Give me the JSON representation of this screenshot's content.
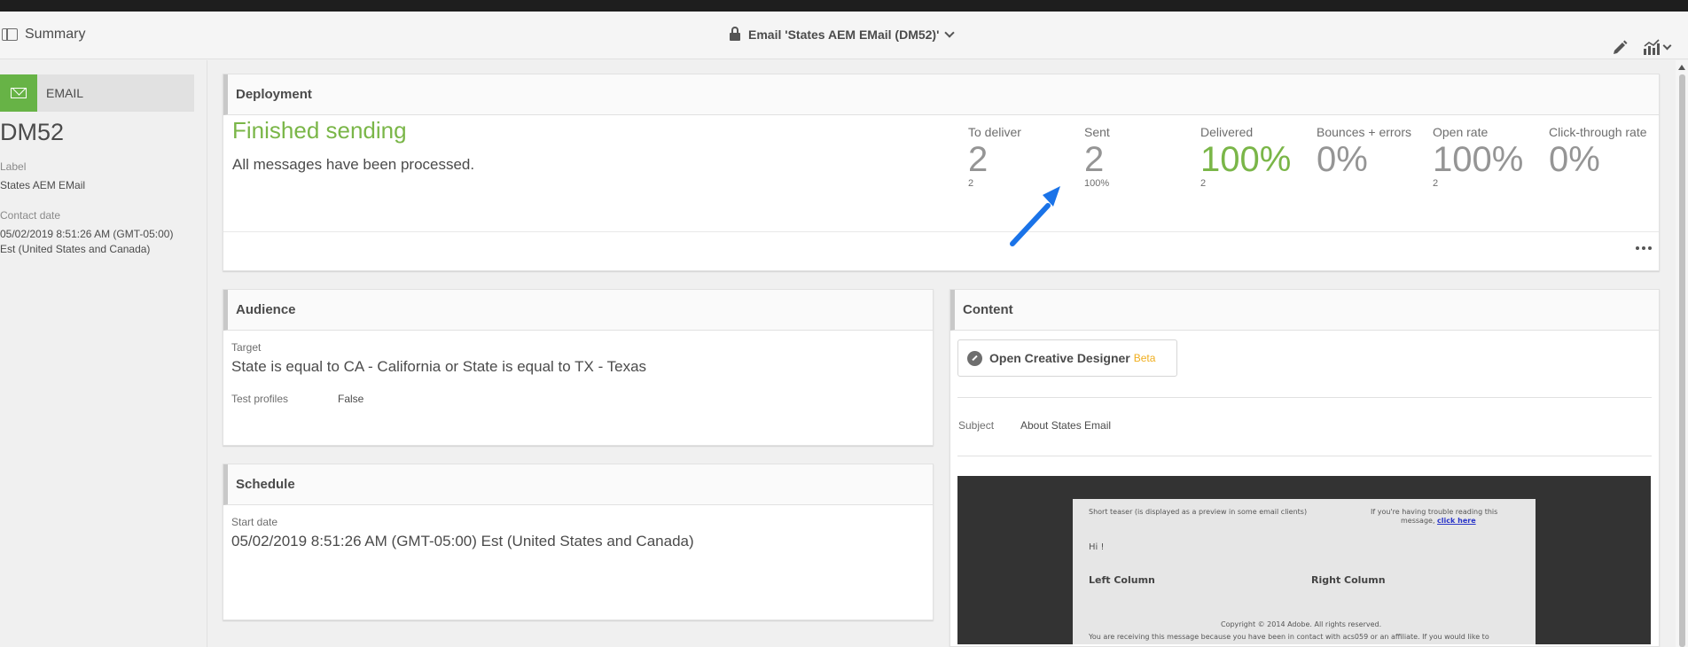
{
  "header": {
    "summary_label": "Summary",
    "title": "Email 'States AEM EMail (DM52)'"
  },
  "sidebar": {
    "channel_label": "EMAIL",
    "code": "DM52",
    "label_caption": "Label",
    "label_value": "States AEM EMail",
    "contact_caption": "Contact date",
    "contact_value": "05/02/2019 8:51:26 AM (GMT-05:00) Est (United States and Canada)"
  },
  "deployment": {
    "title": "Deployment",
    "status": "Finished sending",
    "description": "All messages have been processed.",
    "metrics": [
      {
        "label": "To deliver",
        "value": "2",
        "sub": "2"
      },
      {
        "label": "Sent",
        "value": "2",
        "sub": "100%"
      },
      {
        "label": "Delivered",
        "value": "100%",
        "sub": "2"
      },
      {
        "label": "Bounces + errors",
        "value": "0%",
        "sub": ""
      },
      {
        "label": "Open rate",
        "value": "100%",
        "sub": "2"
      },
      {
        "label": "Click-through rate",
        "value": "0%",
        "sub": ""
      }
    ]
  },
  "audience": {
    "title": "Audience",
    "target_label": "Target",
    "target_value": "State is equal to CA - California or State is equal to TX - Texas",
    "test_label": "Test profiles",
    "test_value": "False"
  },
  "schedule": {
    "title": "Schedule",
    "start_label": "Start date",
    "start_value": "05/02/2019 8:51:26 AM (GMT-05:00) Est (United States and Canada)"
  },
  "content": {
    "title": "Content",
    "designer_button": "Open Creative Designer",
    "beta": "Beta",
    "subject_label": "Subject",
    "subject_value": "About States Email",
    "preview": {
      "teaser": "Short teaser (is displayed as a preview in some email clients)",
      "trouble_1": "If you're having trouble reading this",
      "trouble_2": "message,",
      "click_here": "click here",
      "greeting": "Hi !",
      "left_column": "Left Column",
      "right_column": "Right Column",
      "copyright": "Copyright © 2014 Adobe. All rights reserved.",
      "footer": "You are receiving this message because you have been in contact with acs059 or an affiliate. If you would like to"
    }
  },
  "colors": {
    "accent_green": "#7ab648",
    "channel_green": "#67b346",
    "annotation_arrow": "#1a73e8",
    "beta": "#f0ae1e"
  }
}
